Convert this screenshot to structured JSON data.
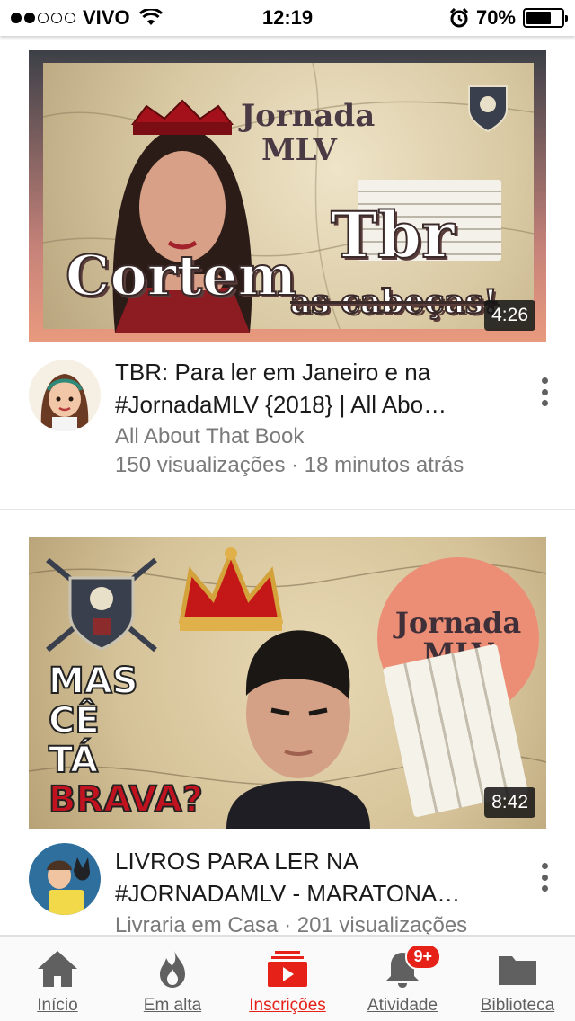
{
  "status_bar": {
    "carrier": "VIVO",
    "time": "12:19",
    "battery": "70%",
    "battery_level": 0.7,
    "signal_bars_filled": 2,
    "signal_bars_total": 5,
    "icons": [
      "wifi-icon",
      "alarm-clock-icon",
      "battery-icon"
    ]
  },
  "feed": {
    "videos": [
      {
        "thumbnail_title": "Cortem",
        "thumbnail_subtitle": "as cabeças!",
        "thumbnail_tag": "Tbr",
        "thumbnail_badge": "Jornada MLV",
        "duration": "4:26",
        "title_line1": "TBR: Para ler em Janeiro e na",
        "title_line2": "#JornadaMLV {2018} | All Abo…",
        "channel": "All About That Book",
        "views": "150 visualizações · 18 minutos atrás"
      },
      {
        "thumbnail_text_1": "MAS",
        "thumbnail_text_2": "CÊ",
        "thumbnail_text_3": "TÁ",
        "thumbnail_text_4": "BRAVA?",
        "thumbnail_badge": "Jornada MLV",
        "duration": "8:42",
        "title_line1": "LIVROS PARA LER NA",
        "title_line2": "#JORNADAMLV - MARATONA…",
        "channel_views": "Livraria em Casa · 201 visualizações"
      }
    ]
  },
  "bottom_nav": {
    "items": [
      {
        "label": "Início",
        "icon": "home-icon"
      },
      {
        "label": "Em alta",
        "icon": "flame-icon"
      },
      {
        "label": "Inscrições",
        "icon": "subscriptions-icon"
      },
      {
        "label": "Atividade",
        "icon": "bell-icon"
      },
      {
        "label": "Biblioteca",
        "icon": "folder-icon"
      }
    ],
    "active": "Inscrições",
    "badge": "9+"
  },
  "colors": {
    "accent": "#e62117",
    "nav_inactive": "#606060",
    "meta_text": "#7a7a7a"
  }
}
